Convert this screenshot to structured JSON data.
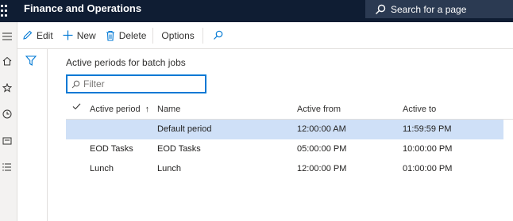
{
  "app": {
    "title": "Finance and Operations",
    "search_placeholder": "Search for a page"
  },
  "actions": {
    "edit": "Edit",
    "new": "New",
    "delete": "Delete",
    "options": "Options"
  },
  "page": {
    "section_title": "Active periods for batch jobs",
    "filter_placeholder": "Filter"
  },
  "grid": {
    "columns": {
      "active_period": "Active period",
      "name": "Name",
      "active_from": "Active from",
      "active_to": "Active to"
    },
    "sort_indicator": "↑",
    "rows": [
      {
        "active_period": "",
        "name": "Default period",
        "active_from": "12:00:00 AM",
        "active_to": "11:59:59 PM",
        "selected": true
      },
      {
        "active_period": "EOD Tasks",
        "name": "EOD Tasks",
        "active_from": "05:00:00 PM",
        "active_to": "10:00:00 PM",
        "selected": false
      },
      {
        "active_period": "Lunch",
        "name": "Lunch",
        "active_from": "12:00:00 PM",
        "active_to": "01:00:00 PM",
        "selected": false
      }
    ]
  },
  "colors": {
    "topbar": "#0f1d33",
    "accent": "#0078d4",
    "selected_row": "#cfe0f7"
  }
}
